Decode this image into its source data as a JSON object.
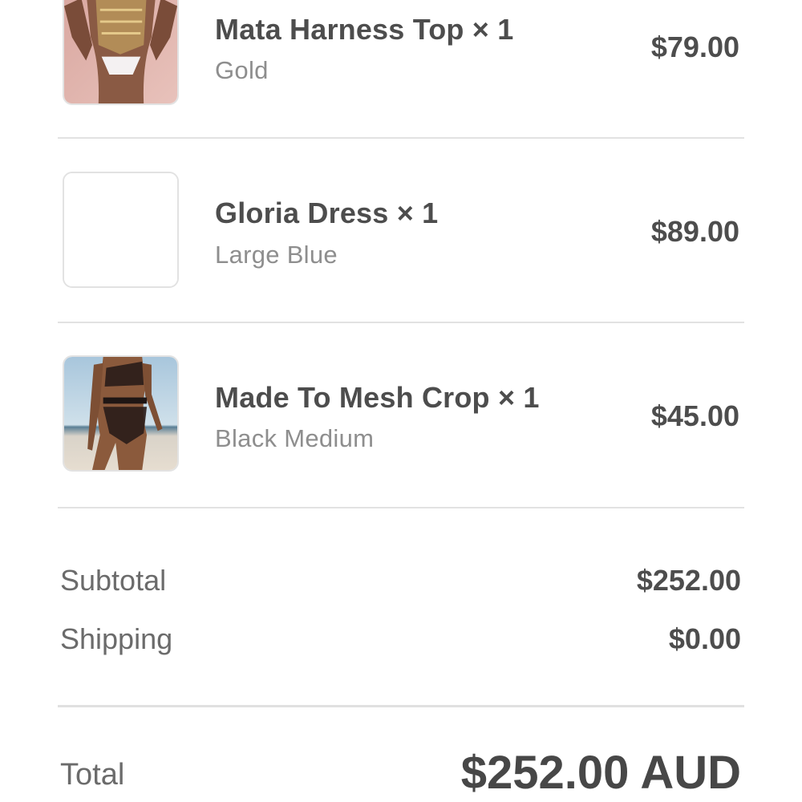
{
  "cart": {
    "items": [
      {
        "name": "Mata Harness Top × 1",
        "variant": "Gold",
        "price": "$79.00",
        "image": "model-gold-harness-photo"
      },
      {
        "name": "Gloria Dress × 1",
        "variant": "Large Blue",
        "price": "$89.00",
        "image": "blank-placeholder"
      },
      {
        "name": "Made To Mesh Crop × 1",
        "variant": "Black Medium",
        "price": "$45.00",
        "image": "model-black-mesh-beach-photo"
      }
    ]
  },
  "summary": {
    "subtotal_label": "Subtotal",
    "subtotal_value": "$252.00",
    "shipping_label": "Shipping",
    "shipping_value": "$0.00",
    "total_label": "Total",
    "total_value": "$252.00 AUD"
  },
  "colors": {
    "text_primary": "#4d4d4d",
    "text_secondary": "#8e8e8e",
    "divider": "#e2e2e2"
  }
}
